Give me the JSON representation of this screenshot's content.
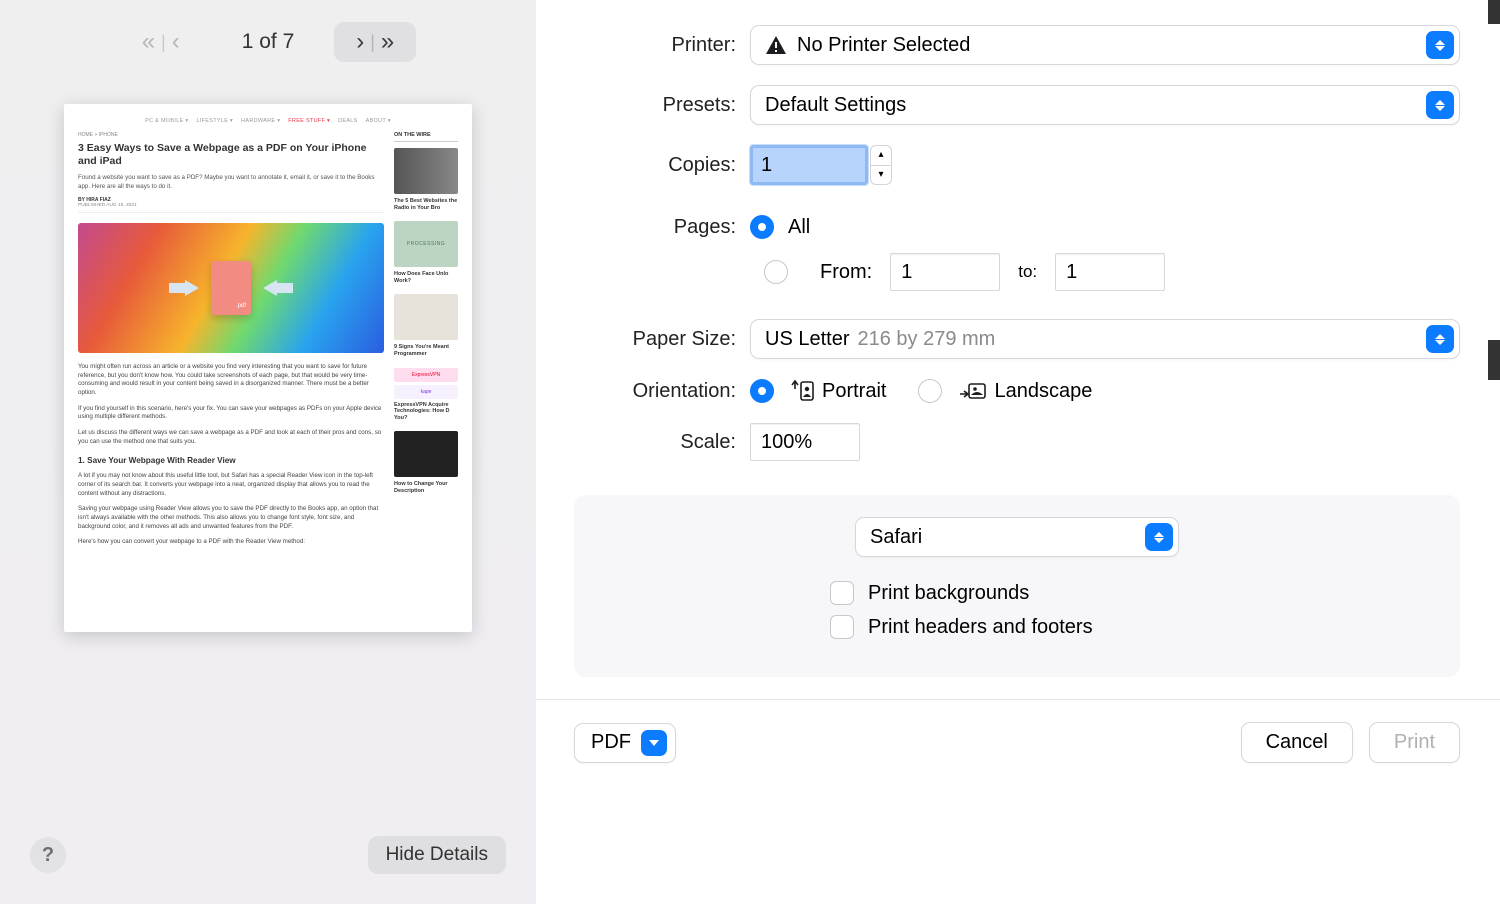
{
  "preview": {
    "page_indicator": "1 of 7",
    "hide_details_label": "Hide Details",
    "help_label": "?",
    "article": {
      "breadcrumb": "HOME > IPHONE",
      "title": "3 Easy Ways to Save a Webpage as a PDF on Your iPhone and iPad",
      "lede": "Found a website you want to save as a PDF? Maybe you want to annotate it, email it, or save it to the Books app. Here are all the ways to do it.",
      "byline": "BY HIRA FIAZ",
      "published": "PUBLISHED AUG 15, 2021",
      "p1": "You might often run across an article or a website you find very interesting that you want to save for future reference, but you don't know how. You could take screenshots of each page, but that would be very time-consuming and would result in your content being saved in a disorganized manner. There must be a better option.",
      "p2": "If you find yourself in this scenario, here's your fix. You can save your webpages as PDFs on your Apple device using multiple different methods.",
      "p3": "Let us discuss the different ways we can save a webpage as a PDF and look at each of their pros and cons, so you can use the method one that suits you.",
      "h2": "1. Save Your Webpage With Reader View",
      "p4": "A lot if you may not know about this useful little tool, but Safari has a special Reader View icon in the top-left corner of its search bar. It converts your webpage into a neat, organized display that allows you to read the content without any distractions.",
      "p5": "Saving your webpage using Reader View allows you to save the PDF directly to the Books app, an option that isn't always available with the other methods. This also allows you to change font style, font size, and background color, and it removes all ads and unwanted features from the PDF.",
      "p6": "Here's how you can convert your webpage to a PDF with the Reader View method:",
      "sidebar_heading": "ON THE WIRE",
      "side1": "The 5 Best Websites the Radio in Your Bro",
      "side2_badge": "PROCESSING",
      "side2": "How Does Face Unlo Work?",
      "side3": "9 Signs You're Meant Programmer",
      "side_logo1": "ExpressVPN",
      "side_logo2": "kape",
      "side4": "ExpressVPN Acquire Technologies: How D You?",
      "side5": "How to Change Your Description"
    }
  },
  "settings": {
    "printer_label": "Printer:",
    "printer_value": "No Printer Selected",
    "presets_label": "Presets:",
    "presets_value": "Default Settings",
    "copies_label": "Copies:",
    "copies_value": "1",
    "pages_label": "Pages:",
    "pages_all_label": "All",
    "pages_from_label": "From:",
    "pages_from_value": "1",
    "pages_to_label": "to:",
    "pages_to_value": "1",
    "paper_size_label": "Paper Size:",
    "paper_size_value": "US Letter",
    "paper_size_dim": "216 by 279 mm",
    "orientation_label": "Orientation:",
    "orientation_portrait": "Portrait",
    "orientation_landscape": "Landscape",
    "scale_label": "Scale:",
    "scale_value": "100%",
    "app_select_value": "Safari",
    "print_backgrounds_label": "Print backgrounds",
    "print_headers_footers_label": "Print headers and footers"
  },
  "footer": {
    "pdf_label": "PDF",
    "cancel_label": "Cancel",
    "print_label": "Print"
  }
}
